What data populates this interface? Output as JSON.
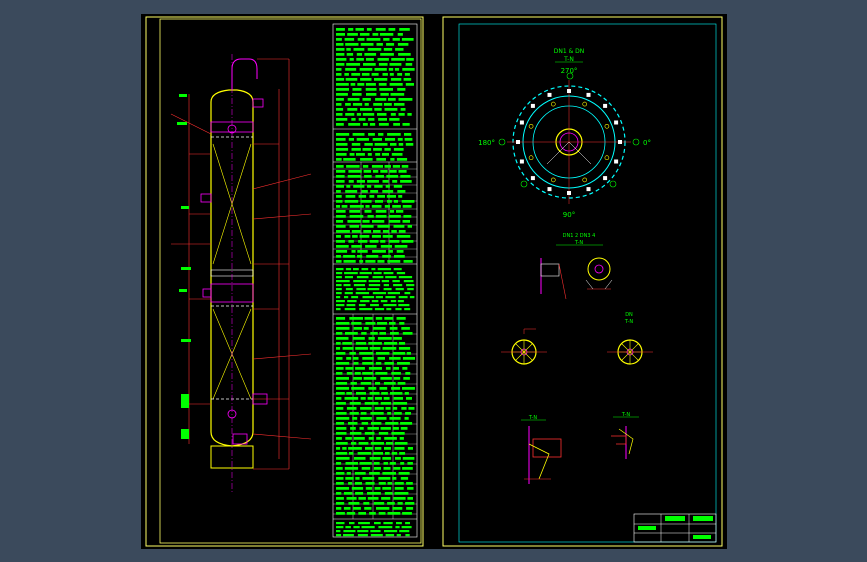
{
  "plan_view": {
    "title_line1": "DN1 & DN",
    "title_line2": "T-N",
    "angle_top": "270°",
    "angle_left": "180°",
    "angle_right": "0°",
    "angle_bottom": "90°"
  },
  "detail_labels": {
    "middle_title": "DN1 2 DN3 4",
    "middle_sub": "T-N",
    "right_small_title_1": "DN",
    "right_small_title_2": "T-N",
    "lower_left_title": "T-N",
    "lower_right_title": "T-N"
  },
  "colors": {
    "background": "#3b4a5c",
    "canvas": "#000000",
    "frame": "#ffff66",
    "vessel": "#ffff00",
    "nozzle": "#ff00ff",
    "dimension": "#ff3030",
    "text_green": "#00ff00",
    "plan_cyan": "#00ffff",
    "detail_red": "#ff3030"
  }
}
